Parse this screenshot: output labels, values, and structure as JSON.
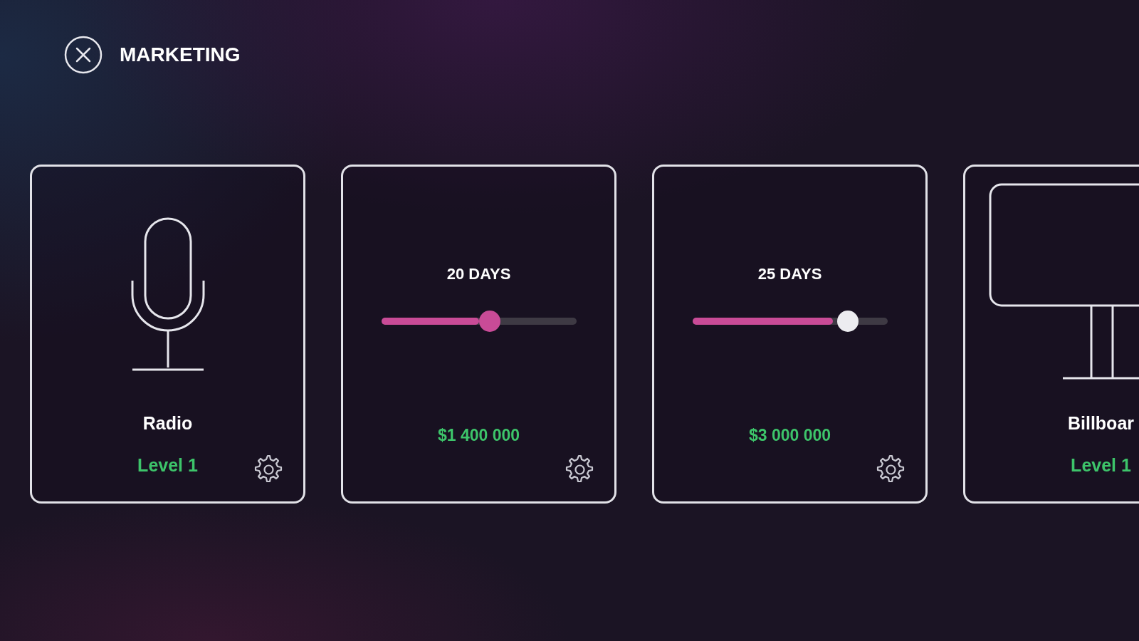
{
  "header": {
    "title": "MARKETING"
  },
  "cards": [
    {
      "kind": "radio",
      "name": "Radio",
      "level_text": "Level 1"
    },
    {
      "kind": "campaign",
      "duration": "20 DAYS",
      "level": 0.5,
      "focused": false,
      "price": "$1 400 000"
    },
    {
      "kind": "campaign",
      "duration": "25 DAYS",
      "level": 0.72,
      "focused": true,
      "price": "$3 000 000"
    },
    {
      "kind": "billboard",
      "name": "Billboar",
      "level_text": "Level 1"
    }
  ]
}
